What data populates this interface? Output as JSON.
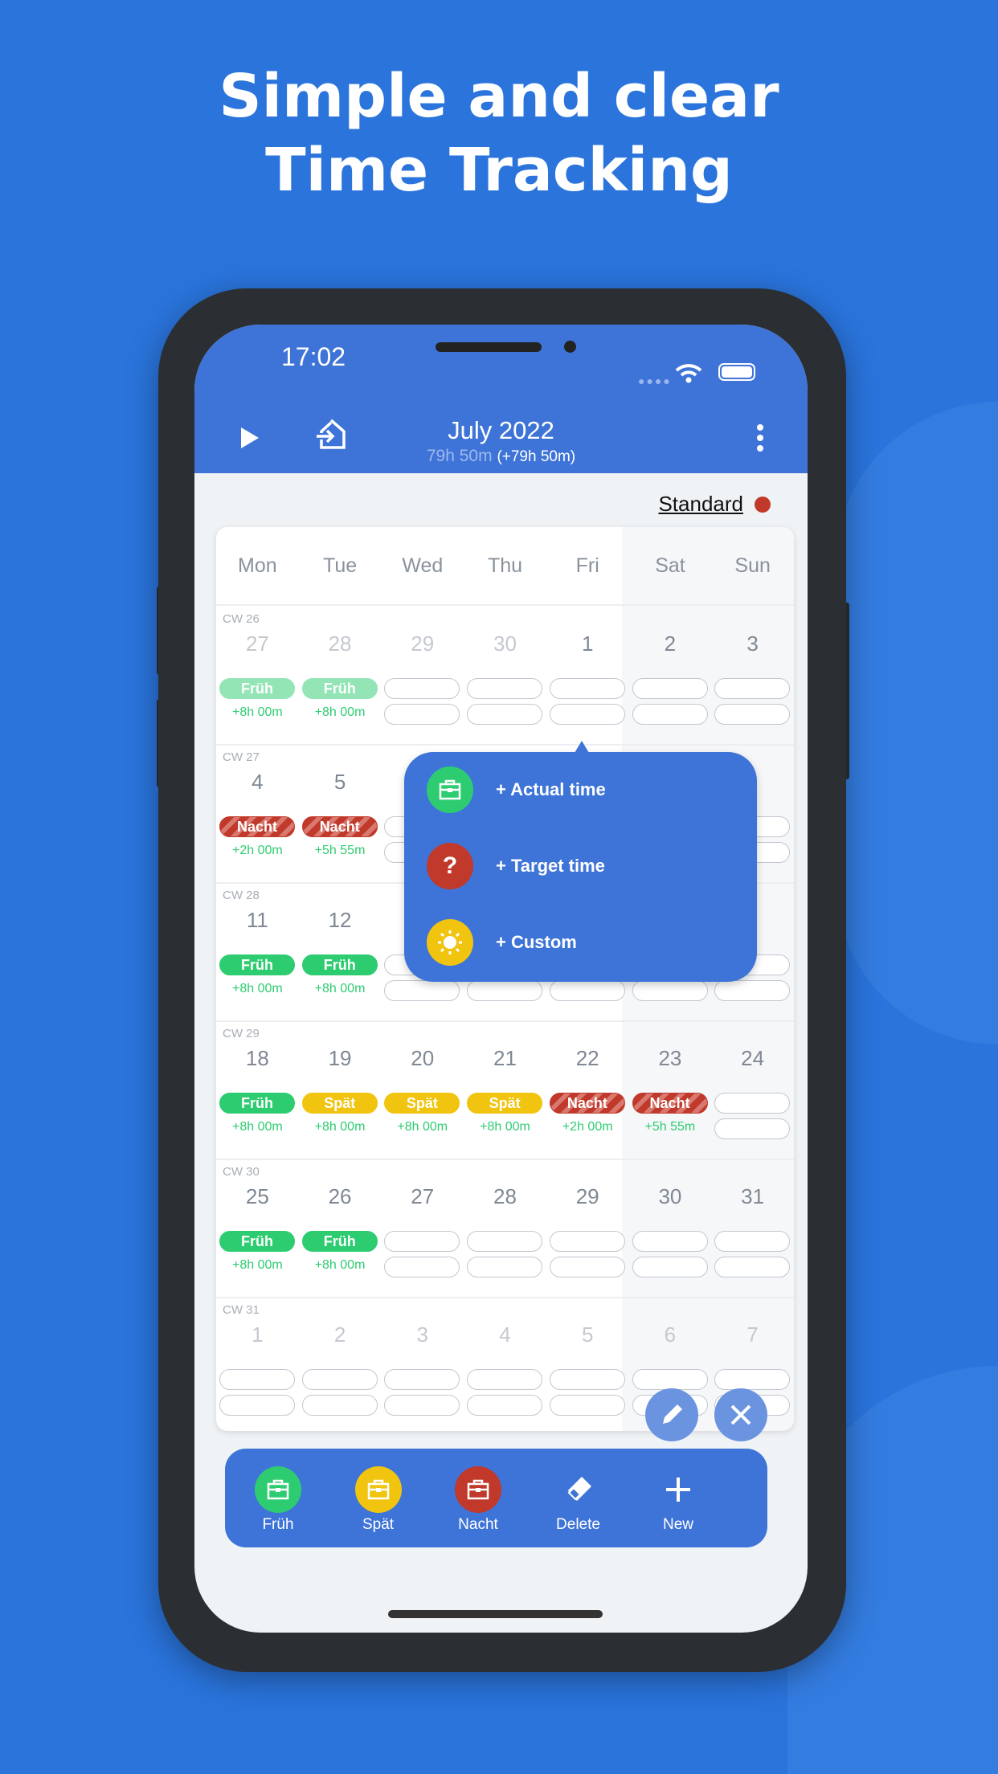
{
  "headline": [
    "Simple and clear",
    "Time Tracking"
  ],
  "status": {
    "time": "17:02"
  },
  "header": {
    "title": "July 2022",
    "total": "79h 50m",
    "balance": "(+79h 50m)"
  },
  "profile": {
    "label": "Standard",
    "color": "#c0392b"
  },
  "colors": {
    "background": "#2a74dc",
    "accent": "#3e74d8",
    "fruh": "#2ecc71",
    "spat": "#f1c40f",
    "nacht": "#c0392b"
  },
  "calendar": {
    "weekdays": [
      "Mon",
      "Tue",
      "Wed",
      "Thu",
      "Fri",
      "Sat",
      "Sun"
    ],
    "weeks": [
      {
        "cw": "CW 26",
        "days": [
          {
            "num": "27",
            "muted": true,
            "shift": "Früh",
            "type": "fruhl",
            "time": "+8h 00m"
          },
          {
            "num": "28",
            "muted": true,
            "shift": "Früh",
            "type": "fruhl",
            "time": "+8h 00m"
          },
          {
            "num": "29",
            "muted": true
          },
          {
            "num": "30",
            "muted": true
          },
          {
            "num": "1"
          },
          {
            "num": "2"
          },
          {
            "num": "3"
          }
        ]
      },
      {
        "cw": "CW 27",
        "days": [
          {
            "num": "4",
            "shift": "Nacht",
            "type": "nacht",
            "time": "+2h 00m"
          },
          {
            "num": "5",
            "shift": "Nacht",
            "type": "nacht",
            "time": "+5h 55m"
          },
          {
            "num": ""
          },
          {
            "num": ""
          },
          {
            "num": ""
          },
          {
            "num": ""
          },
          {
            "num": ""
          }
        ]
      },
      {
        "cw": "CW 28",
        "days": [
          {
            "num": "11",
            "shift": "Früh",
            "type": "fruh",
            "time": "+8h 00m"
          },
          {
            "num": "12",
            "shift": "Früh",
            "type": "fruh",
            "time": "+8h 00m"
          },
          {
            "num": ""
          },
          {
            "num": ""
          },
          {
            "num": ""
          },
          {
            "num": ""
          },
          {
            "num": ""
          }
        ]
      },
      {
        "cw": "CW 29",
        "days": [
          {
            "num": "18",
            "shift": "Früh",
            "type": "fruh",
            "time": "+8h 00m"
          },
          {
            "num": "19",
            "shift": "Spät",
            "type": "spat",
            "time": "+8h 00m"
          },
          {
            "num": "20",
            "shift": "Spät",
            "type": "spat",
            "time": "+8h 00m"
          },
          {
            "num": "21",
            "shift": "Spät",
            "type": "spat",
            "time": "+8h 00m"
          },
          {
            "num": "22",
            "shift": "Nacht",
            "type": "nacht",
            "time": "+2h 00m"
          },
          {
            "num": "23",
            "shift": "Nacht",
            "type": "nacht",
            "time": "+5h 55m"
          },
          {
            "num": "24"
          }
        ]
      },
      {
        "cw": "CW 30",
        "days": [
          {
            "num": "25",
            "shift": "Früh",
            "type": "fruh",
            "time": "+8h 00m"
          },
          {
            "num": "26",
            "shift": "Früh",
            "type": "fruh",
            "time": "+8h 00m"
          },
          {
            "num": "27"
          },
          {
            "num": "28"
          },
          {
            "num": "29"
          },
          {
            "num": "30"
          },
          {
            "num": "31"
          }
        ]
      },
      {
        "cw": "CW 31",
        "days": [
          {
            "num": "1",
            "muted": true
          },
          {
            "num": "2",
            "muted": true
          },
          {
            "num": "3",
            "muted": true
          },
          {
            "num": "4",
            "muted": true
          },
          {
            "num": "5",
            "muted": true
          },
          {
            "num": "6",
            "muted": true
          },
          {
            "num": "7",
            "muted": true
          }
        ]
      }
    ]
  },
  "popup": {
    "items": [
      {
        "label": "+ Actual time",
        "icon": "briefcase-icon",
        "color": "#2ecc71"
      },
      {
        "label": "+ Target time",
        "icon": "question-icon",
        "color": "#c0392b"
      },
      {
        "label": "+ Custom",
        "icon": "sun-icon",
        "color": "#f1c40f"
      }
    ]
  },
  "toolbar": {
    "items": [
      {
        "label": "Früh",
        "icon": "briefcase-icon",
        "color": "#2ecc71"
      },
      {
        "label": "Spät",
        "icon": "briefcase-icon",
        "color": "#f1c40f"
      },
      {
        "label": "Nacht",
        "icon": "briefcase-icon",
        "color": "#c0392b"
      },
      {
        "label": "Delete",
        "icon": "eraser-icon"
      },
      {
        "label": "New",
        "icon": "plus-icon"
      }
    ]
  }
}
